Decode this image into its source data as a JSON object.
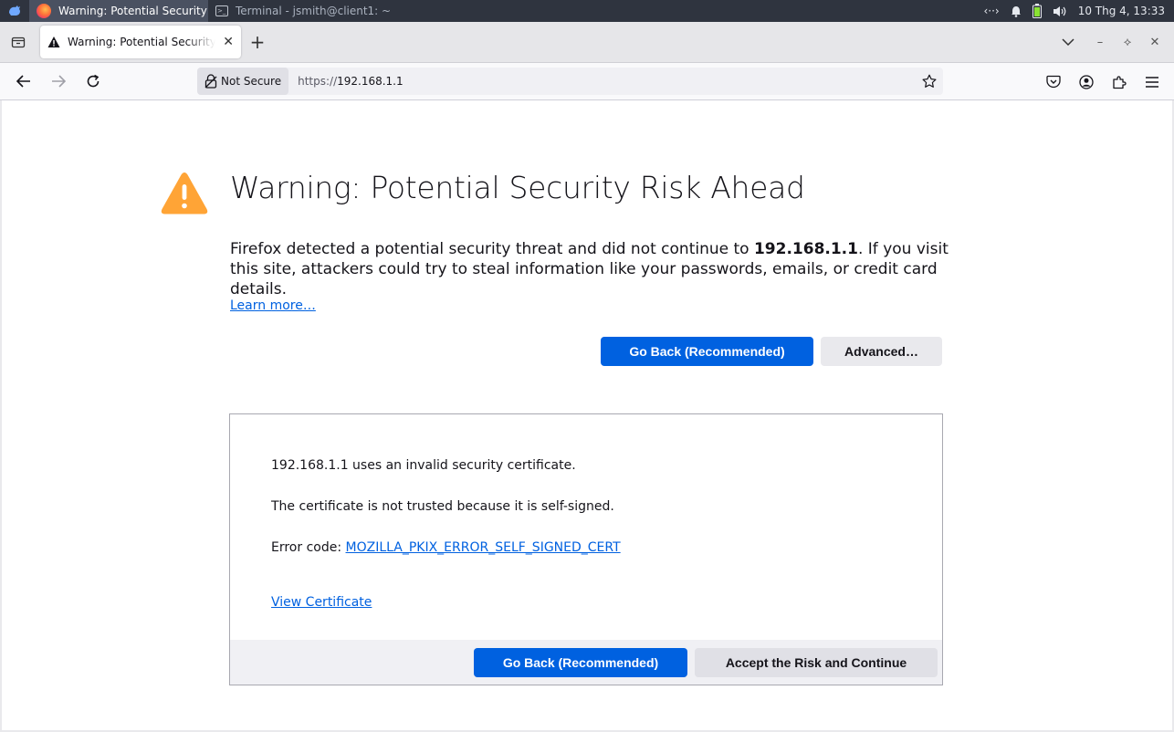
{
  "taskbar": {
    "tasks": [
      {
        "label": "Warning: Potential Security ...",
        "active": true
      },
      {
        "label": "Terminal - jsmith@client1: ~",
        "active": false
      }
    ],
    "clock": "10 Thg 4, 13:33",
    "network_glyph": "‹··›"
  },
  "tabstrip": {
    "tab_title": "Warning: Potential Security Risk Ahead",
    "new_tab": "+"
  },
  "navbar": {
    "not_secure_label": "Not Secure",
    "url_scheme": "https://",
    "url_host": "192.168.1.1"
  },
  "content": {
    "title": "Warning: Potential Security Risk Ahead",
    "desc_before": "Firefox detected a potential security threat and did not continue to ",
    "desc_host": "192.168.1.1",
    "desc_after": ". If you visit this site, attackers could try to steal information like your passwords, emails, or credit card details.",
    "learn_more": "Learn more…",
    "go_back": "Go Back (Recommended)",
    "advanced": "Advanced…"
  },
  "advanced_panel": {
    "line1": "192.168.1.1 uses an invalid security certificate.",
    "line2": "The certificate is not trusted because it is self-signed.",
    "error_code_label": "Error code: ",
    "error_code": "MOZILLA_PKIX_ERROR_SELF_SIGNED_CERT",
    "view_certificate": "View Certificate",
    "go_back": "Go Back (Recommended)",
    "accept": "Accept the Risk and Continue"
  },
  "colors": {
    "accent_blue": "#0061e0",
    "warning_orange": "#ffa436",
    "taskbar_bg": "#2f343f"
  }
}
